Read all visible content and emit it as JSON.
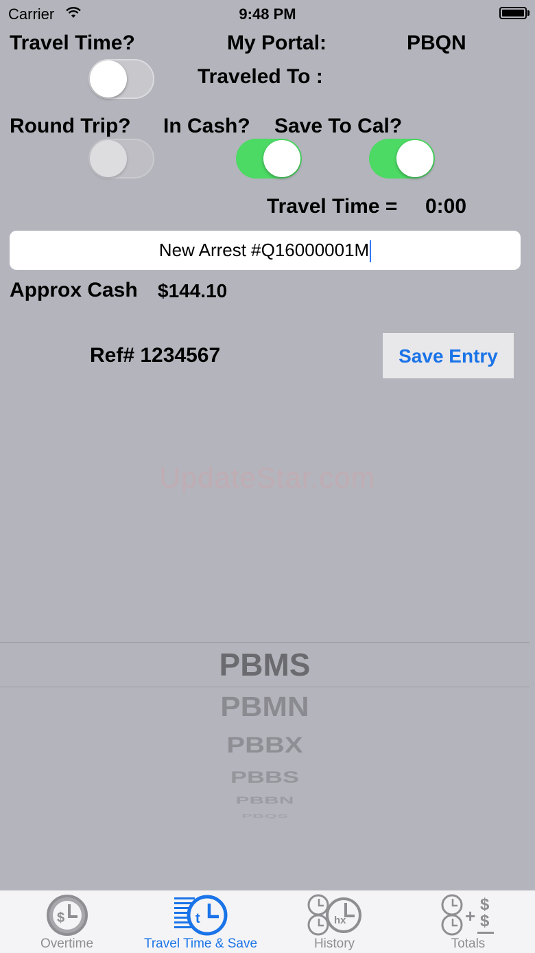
{
  "status_bar": {
    "carrier": "Carrier",
    "time": "9:48 PM"
  },
  "labels": {
    "travel_time_q": "Travel Time?",
    "my_portal": "My Portal:",
    "portal_value": "PBQN",
    "traveled_to": "Traveled To :",
    "round_trip_q": "Round Trip?",
    "in_cash_q": "In Cash?",
    "save_to_cal_q": "Save To Cal?",
    "travel_time_eq": "Travel Time =",
    "travel_time_value": "0:00",
    "approx_cash": "Approx Cash",
    "approx_cash_value": "$144.10",
    "ref": "Ref# 1234567"
  },
  "toggles": {
    "travel_time": false,
    "round_trip": false,
    "in_cash": true,
    "save_to_cal": true
  },
  "entry_field": {
    "value": "New Arrest #Q16000001M"
  },
  "save_button": {
    "label": "Save Entry"
  },
  "watermark": "UpdateStar.com",
  "picker": {
    "selected": "PBMS",
    "items": [
      "PBMN",
      "PBBX",
      "PBBS",
      "PBBN",
      "PBQS"
    ]
  },
  "tabs": [
    {
      "label": "Overtime",
      "icon": "overtime-clock-dollar-icon",
      "active": false
    },
    {
      "label": "Travel Time & Save",
      "icon": "travel-time-icon",
      "active": true
    },
    {
      "label": "History",
      "icon": "history-clocks-icon",
      "active": false
    },
    {
      "label": "Totals",
      "icon": "totals-clocks-plus-dollar-icon",
      "active": false
    }
  ],
  "colors": {
    "background": "#b4b4bc",
    "accent": "#1a73e8",
    "toggle_on": "#4cd964"
  }
}
